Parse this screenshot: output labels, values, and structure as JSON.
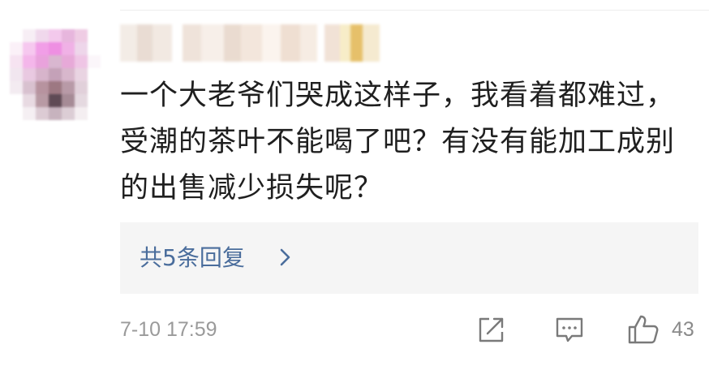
{
  "comment": {
    "text": "一个大老爷们哭成这样子，我看着都难过，受潮的茶叶不能喝了吧？有没有能加工成别的出售减少损失呢？",
    "replies_label": "共5条回复",
    "timestamp": "7-10 17:59",
    "likes": "43"
  },
  "colors": {
    "text": "#1f1f1f",
    "link": "#4a6d9c",
    "meta": "#9a9a9a",
    "reply_bg": "#f5f5f5"
  },
  "icons": {
    "share": "share-icon",
    "comment": "comment-icon",
    "like": "thumbs-up-icon",
    "chevron": "chevron-right-icon"
  }
}
